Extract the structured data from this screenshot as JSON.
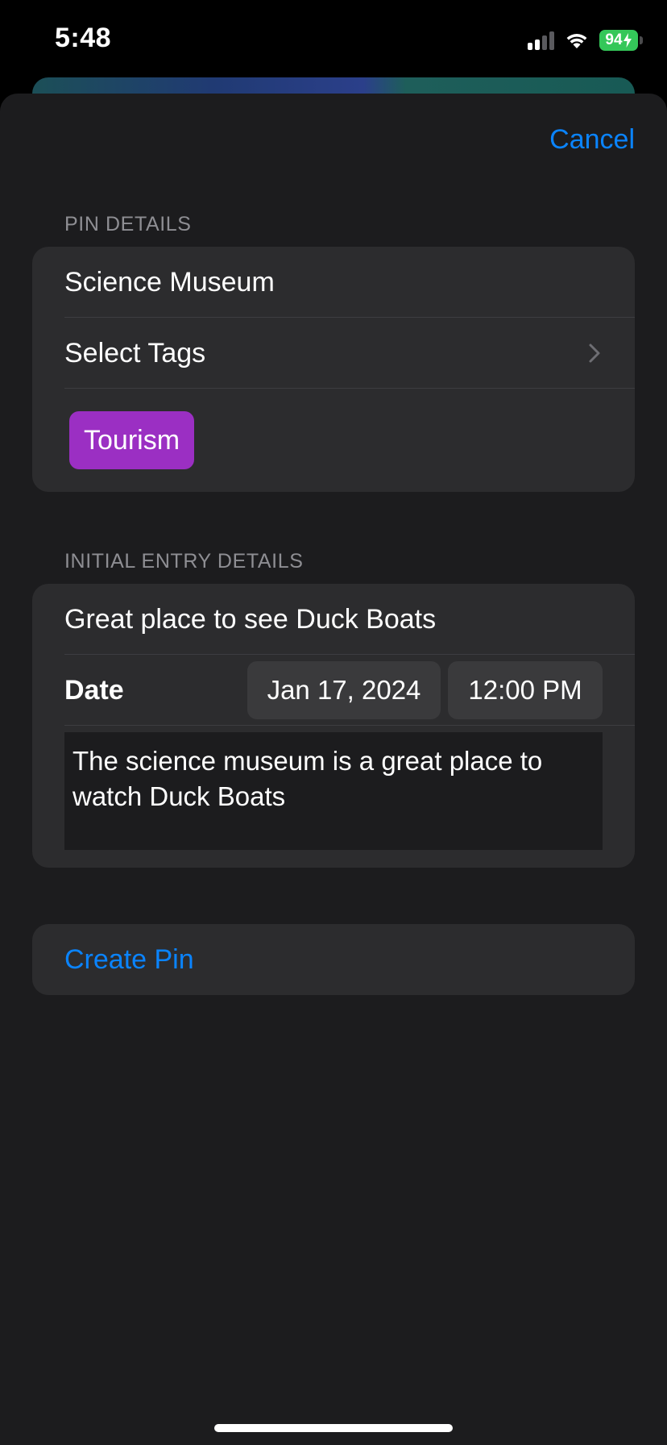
{
  "status_bar": {
    "time": "5:48",
    "battery_level": "94",
    "battery_color": "#34c759",
    "signal_icon": "signal-icon",
    "wifi_icon": "wifi-icon",
    "battery_icon": "battery-charging-icon"
  },
  "nav": {
    "cancel_label": "Cancel"
  },
  "pin_details": {
    "section_title": "PIN DETAILS",
    "name_value": "Science Museum",
    "select_tags_label": "Select Tags",
    "tags": [
      "Tourism"
    ],
    "tag_color": "#9b2fc3"
  },
  "entry_details": {
    "section_title": "INITIAL ENTRY DETAILS",
    "title_value": "Great place to see Duck Boats",
    "date_label": "Date",
    "date_value": "Jan 17, 2024",
    "time_value": "12:00 PM",
    "notes_value": "The science museum is a great place to watch Duck Boats"
  },
  "actions": {
    "create_label": "Create Pin"
  },
  "colors": {
    "accent": "#0a84ff",
    "sheet_background": "#1c1c1e",
    "group_background": "#2c2c2e"
  }
}
